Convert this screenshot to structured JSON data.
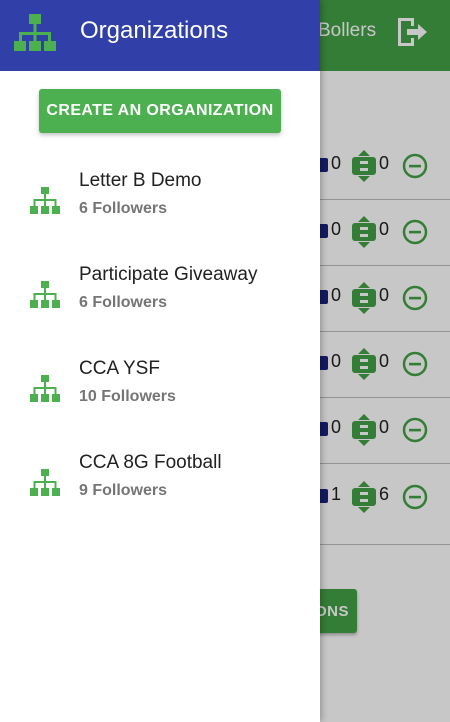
{
  "background": {
    "appbar_title": "Bollers",
    "rows": [
      {
        "a": "0",
        "b": "0"
      },
      {
        "a": "0",
        "b": "0"
      },
      {
        "a": "0",
        "b": "0"
      },
      {
        "a": "0",
        "b": "0"
      },
      {
        "a": "0",
        "b": "0"
      },
      {
        "a": "1",
        "b": "6"
      }
    ],
    "bottom_button_label": "ONS"
  },
  "drawer": {
    "title": "Organizations",
    "create_button_label": "CREATE AN ORGANIZATION",
    "organizations": [
      {
        "name": "Letter B Demo",
        "followers": "6 Followers"
      },
      {
        "name": "Participate Giveaway",
        "followers": "6 Followers"
      },
      {
        "name": "CCA YSF",
        "followers": "10 Followers"
      },
      {
        "name": "CCA 8G Football",
        "followers": "9 Followers"
      }
    ]
  },
  "colors": {
    "drawer_header": "#3040a8",
    "accent_green": "#4caf50",
    "appbar_green": "#43a047"
  }
}
